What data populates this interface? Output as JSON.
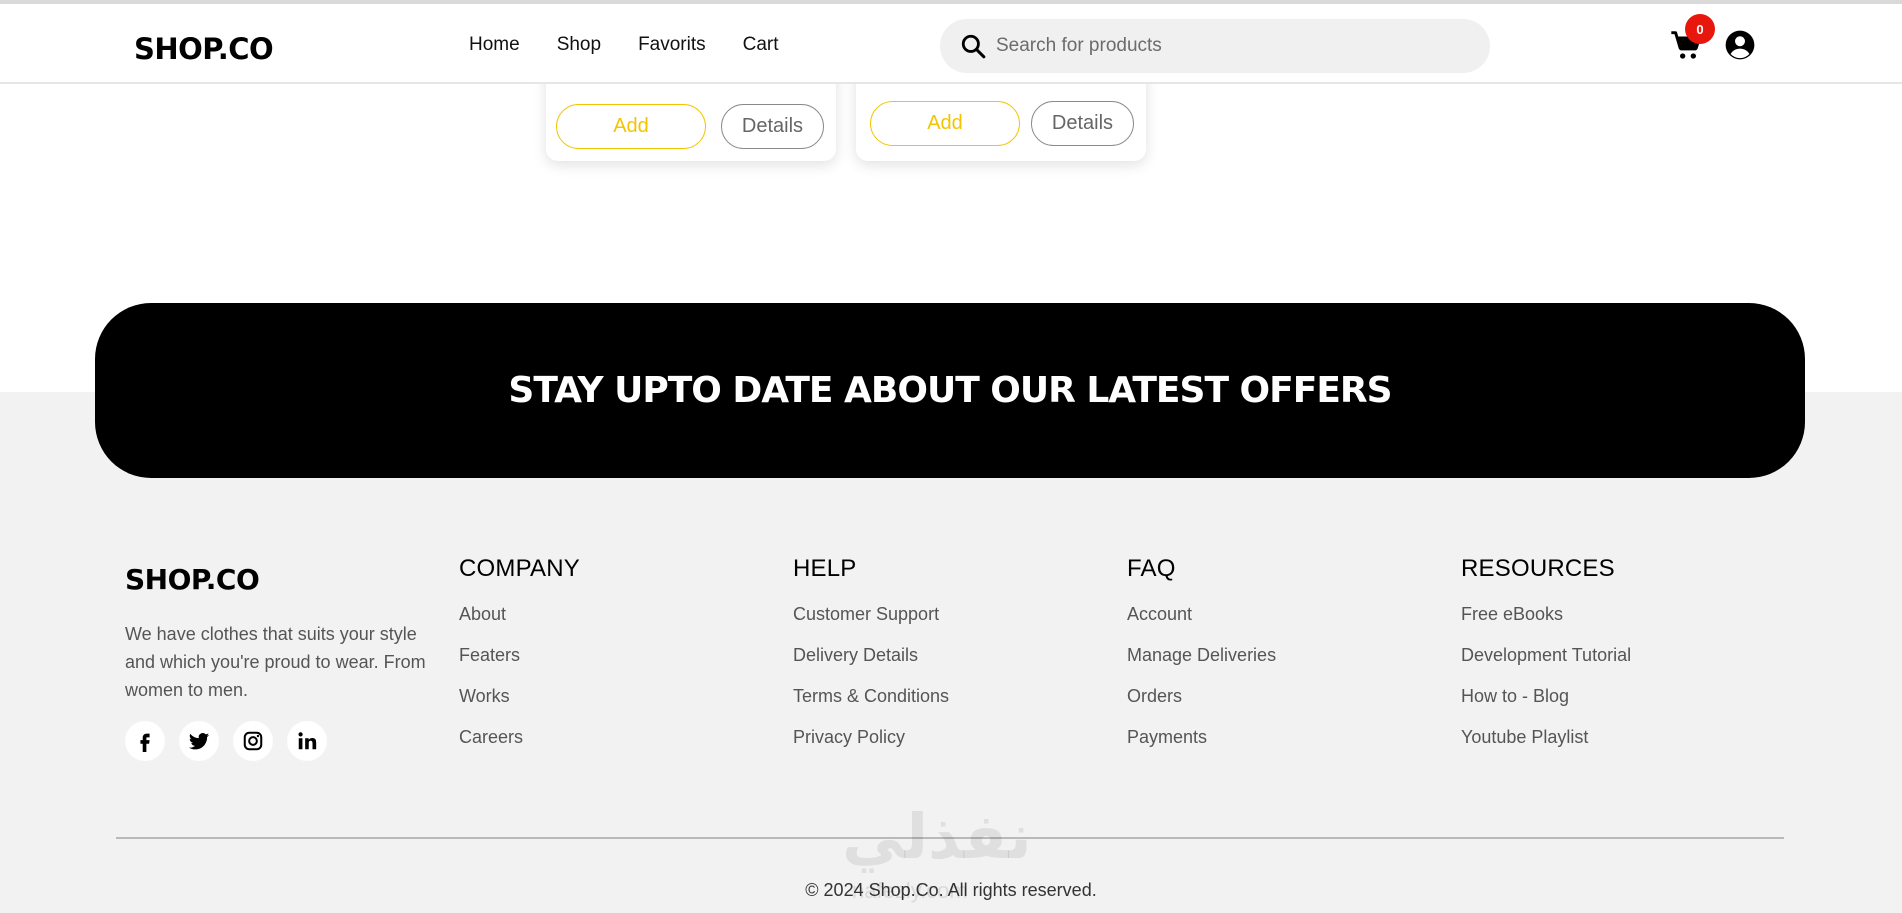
{
  "header": {
    "logo": "SHOP.CO",
    "nav": [
      "Home",
      "Shop",
      "Favorits",
      "Cart"
    ],
    "search_placeholder": "Search for products",
    "cart_count": "0"
  },
  "product_cards": [
    {
      "add_label": "Add",
      "details_label": "Details"
    },
    {
      "add_label": "Add",
      "details_label": "Details"
    }
  ],
  "newsletter": {
    "title": "STAY UPTO DATE ABOUT OUR LATEST OFFERS"
  },
  "footer": {
    "logo": "SHOP.CO",
    "description": "We have clothes that suits your style and which you're proud to wear. From women to men.",
    "social_icons": [
      "facebook-icon",
      "twitter-icon",
      "instagram-icon",
      "linkedin-icon"
    ],
    "columns": [
      {
        "title": "COMPANY",
        "links": [
          "About",
          "Featers",
          "Works",
          "Careers"
        ]
      },
      {
        "title": "HELP",
        "links": [
          "Customer Support",
          "Delivery Details",
          "Terms & Conditions",
          "Privacy Policy"
        ]
      },
      {
        "title": "FAQ",
        "links": [
          "Account",
          "Manage Deliveries",
          "Orders",
          "Payments"
        ]
      },
      {
        "title": "RESOURCES",
        "links": [
          "Free eBooks",
          "Development Tutorial",
          "How to - Blog",
          "Youtube Playlist"
        ]
      }
    ],
    "copyright": "© 2024 Shop.Co. All rights reserved."
  },
  "watermark": {
    "arabic": "نفذلي",
    "latin": "nafezly.com"
  },
  "colors": {
    "accent_yellow": "#f2c500",
    "badge_red": "#e8170e",
    "footer_bg": "#f2f2f2",
    "banner_bg": "#000000"
  }
}
